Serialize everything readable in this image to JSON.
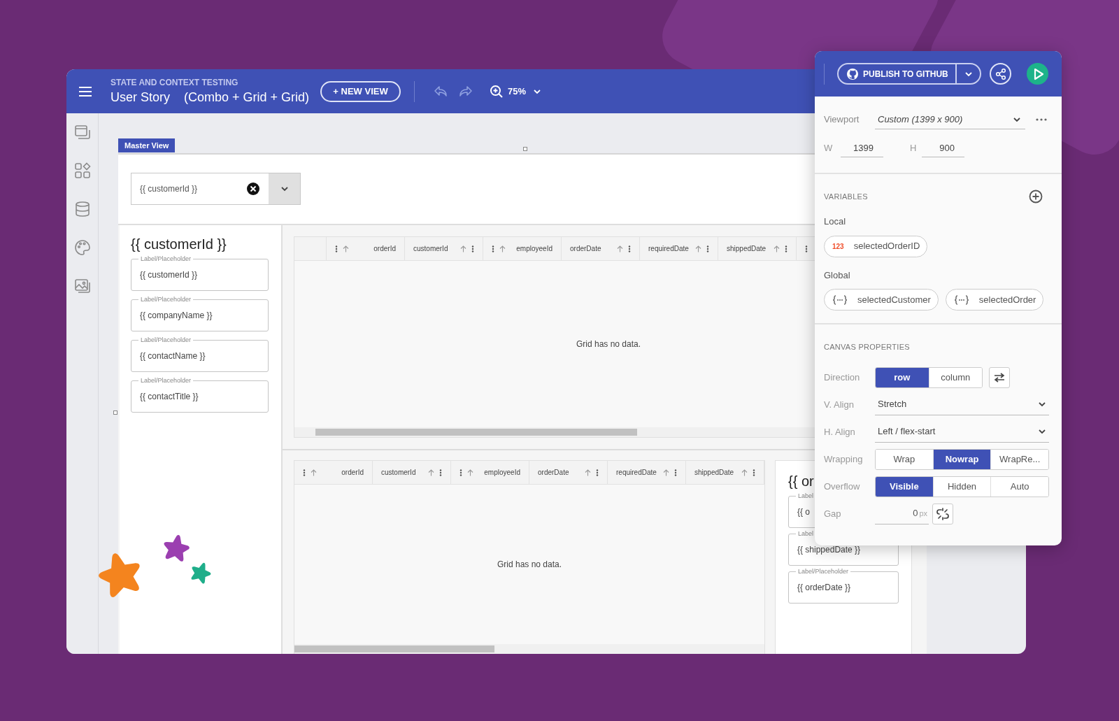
{
  "header": {
    "project": "STATE AND CONTEXT TESTING",
    "title": "User Story",
    "subtitle": "(Combo + Grid + Grid)",
    "new_view_button": "+ NEW VIEW",
    "zoom": "75%"
  },
  "master_view": {
    "tab": "Master View",
    "combo": {
      "value": "{{ customerId }}"
    },
    "detail_card": {
      "title": "{{ customerId }}",
      "fields": [
        {
          "label": "Label/Placeholder",
          "value": "{{ customerId }}"
        },
        {
          "label": "Label/Placeholder",
          "value": "{{ companyName }}"
        },
        {
          "label": "Label/Placeholder",
          "value": "{{ contactName }}"
        },
        {
          "label": "Label/Placeholder",
          "value": "{{ contactTitle }}"
        }
      ]
    },
    "grids": [
      {
        "leading_column": true,
        "empty_text": "Grid has no data.",
        "columns": [
          {
            "label": "orderId",
            "kind": "icons_left"
          },
          {
            "label": "customerId",
            "kind": "icons_right"
          },
          {
            "label": "employeeId",
            "kind": "icons_left"
          },
          {
            "label": "orderDate",
            "kind": "icons_right"
          },
          {
            "label": "requiredDate",
            "kind": "icons_right"
          },
          {
            "label": "shippedDate",
            "kind": "icons_right"
          },
          {
            "kind": "menu_only"
          }
        ]
      },
      {
        "empty_text": "Grid has no data.",
        "columns": [
          {
            "label": "orderId",
            "kind": "icons_left"
          },
          {
            "label": "customerId",
            "kind": "icons_right"
          },
          {
            "label": "employeeId",
            "kind": "icons_left"
          },
          {
            "label": "orderDate",
            "kind": "icons_right"
          },
          {
            "label": "requiredDate",
            "kind": "icons_right"
          },
          {
            "label": "shippedDate",
            "kind": "icons_right"
          }
        ]
      }
    ],
    "detail_card_2": {
      "title": "{{ or",
      "fields": [
        {
          "label": "Label",
          "value": "{{ o"
        },
        {
          "label": "Label",
          "value": "{{ shippedDate }}"
        },
        {
          "label": "Label/Placeholder",
          "value": "{{ orderDate }}"
        }
      ]
    }
  },
  "panel": {
    "publish_button": "PUBLISH TO GITHUB",
    "viewport": {
      "label": "Viewport",
      "value": "Custom (1399 x 900)"
    },
    "size": [
      {
        "label": "W",
        "value": "1399"
      },
      {
        "label": "H",
        "value": "900"
      }
    ],
    "variables": {
      "heading": "VARIABLES",
      "groups": [
        {
          "label": "Local",
          "items": [
            {
              "kind": "number",
              "type_label": "123",
              "name": "selectedOrderID"
            }
          ]
        },
        {
          "label": "Global",
          "items": [
            {
              "kind": "object",
              "name": "selectedCustomer"
            },
            {
              "kind": "object",
              "name": "selectedOrder"
            }
          ]
        }
      ]
    },
    "canvas_properties": {
      "heading": "CANVAS PROPERTIES",
      "rows": [
        {
          "kind": "segmented",
          "label": "Direction",
          "swap_button": true,
          "options": [
            {
              "label": "row",
              "selected": true
            },
            {
              "label": "column",
              "selected": false
            }
          ]
        },
        {
          "kind": "select",
          "label": "V. Align",
          "value": "Stretch"
        },
        {
          "kind": "select",
          "label": "H. Align",
          "value": "Left / flex-start"
        },
        {
          "kind": "segmented",
          "label": "Wrapping",
          "options": [
            {
              "label": "Wrap",
              "selected": false
            },
            {
              "label": "Nowrap",
              "selected": true
            },
            {
              "label": "WrapRe...",
              "selected": false
            }
          ]
        },
        {
          "kind": "segmented",
          "label": "Overflow",
          "options": [
            {
              "label": "Visible",
              "selected": true
            },
            {
              "label": "Hidden",
              "selected": false
            },
            {
              "label": "Auto",
              "selected": false
            }
          ]
        },
        {
          "kind": "number",
          "label": "Gap",
          "value": "0",
          "unit": "px",
          "unlink_button": true
        }
      ]
    }
  }
}
